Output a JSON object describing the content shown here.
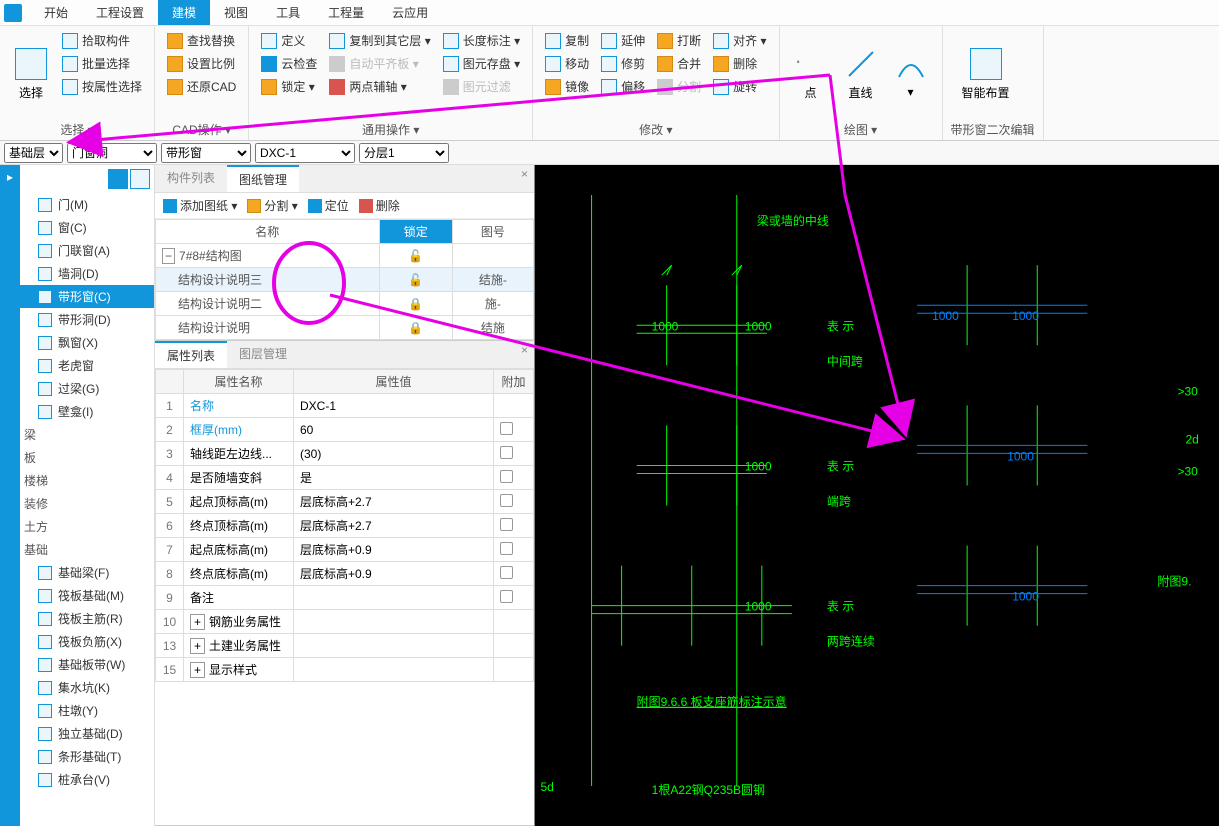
{
  "menu": {
    "items": [
      "开始",
      "工程设置",
      "建模",
      "视图",
      "工具",
      "工程量",
      "云应用"
    ],
    "active_index": 2
  },
  "ribbon": {
    "select_group": {
      "big": "选择",
      "items": [
        "拾取构件",
        "批量选择",
        "按属性选择"
      ],
      "title": "选择 ▾"
    },
    "cad_group": {
      "items": [
        "查找替换",
        "设置比例",
        "还原CAD"
      ],
      "title": "CAD操作 ▾"
    },
    "general_group": {
      "col1": [
        "定义",
        "云检查",
        "锁定 ▾"
      ],
      "col2": [
        "复制到其它层 ▾",
        "自动平齐板 ▾",
        "两点辅轴 ▾"
      ],
      "col3": [
        "长度标注 ▾",
        "图元存盘 ▾",
        "图元过滤"
      ],
      "title": "通用操作 ▾"
    },
    "modify_group": {
      "col1": [
        "复制",
        "移动",
        "镜像"
      ],
      "col2": [
        "延伸",
        "修剪",
        "偏移"
      ],
      "col3": [
        "打断",
        "合并",
        "分割"
      ],
      "col4": [
        "对齐 ▾",
        "删除",
        "旋转"
      ],
      "title": "修改 ▾"
    },
    "draw_group": {
      "items": [
        "点",
        "直线"
      ],
      "title": "绘图 ▾"
    },
    "smart_group": {
      "big": "智能布置",
      "title": "带形窗二次编辑"
    }
  },
  "combos": {
    "layer": "基础层",
    "category": "门窗洞",
    "type": "带形窗",
    "name": "DXC-1",
    "floor": "分层1"
  },
  "tree": {
    "items_top": [
      {
        "label": "门(M)"
      },
      {
        "label": "窗(C)"
      },
      {
        "label": "门联窗(A)"
      },
      {
        "label": "墙洞(D)"
      },
      {
        "label": "带形窗(C)",
        "selected": true
      },
      {
        "label": "带形洞(D)"
      },
      {
        "label": "飘窗(X)"
      },
      {
        "label": "老虎窗"
      },
      {
        "label": "过梁(G)"
      },
      {
        "label": "壁龛(I)"
      }
    ],
    "groups": [
      "梁",
      "板",
      "楼梯",
      "装修",
      "土方"
    ],
    "foundation_label": "基础",
    "foundation_items": [
      "基础梁(F)",
      "筏板基础(M)",
      "筏板主筋(R)",
      "筏板负筋(X)",
      "基础板带(W)",
      "集水坑(K)",
      "柱墩(Y)",
      "独立基础(D)",
      "条形基础(T)",
      "桩承台(V)"
    ]
  },
  "drawing_panel": {
    "tab1": "构件列表",
    "tab2": "图纸管理",
    "toolbar": [
      "添加图纸 ▾",
      "分割 ▾",
      "定位",
      "删除"
    ],
    "headers": {
      "name": "名称",
      "lock": "锁定",
      "num": "图号"
    },
    "rows": [
      {
        "name": "7#8#结构图",
        "expand": "−",
        "lock": "🔓",
        "num": ""
      },
      {
        "name": "结构设计说明三",
        "lock": "🔓",
        "num": "结施-",
        "selected": true
      },
      {
        "name": "结构设计说明二",
        "lock": "🔒",
        "num": "施-"
      },
      {
        "name": "结构设计说明",
        "lock": "🔒",
        "num": "结施"
      }
    ]
  },
  "prop_panel": {
    "tab1": "属性列表",
    "tab2": "图层管理",
    "headers": {
      "name": "属性名称",
      "value": "属性值",
      "extra": "附加"
    },
    "rows": [
      {
        "n": "1",
        "name": "名称",
        "value": "DXC-1",
        "link": true
      },
      {
        "n": "2",
        "name": "框厚(mm)",
        "value": "60",
        "link": true,
        "chk": true
      },
      {
        "n": "3",
        "name": "轴线距左边线...",
        "value": "(30)",
        "chk": true
      },
      {
        "n": "4",
        "name": "是否随墙变斜",
        "value": "是",
        "chk": true
      },
      {
        "n": "5",
        "name": "起点顶标高(m)",
        "value": "层底标高+2.7",
        "chk": true
      },
      {
        "n": "6",
        "name": "终点顶标高(m)",
        "value": "层底标高+2.7",
        "chk": true
      },
      {
        "n": "7",
        "name": "起点底标高(m)",
        "value": "层底标高+0.9",
        "chk": true
      },
      {
        "n": "8",
        "name": "终点底标高(m)",
        "value": "层底标高+0.9",
        "chk": true
      },
      {
        "n": "9",
        "name": "备注",
        "value": "",
        "chk": true
      },
      {
        "n": "10",
        "name": "钢筋业务属性",
        "value": "",
        "expand": true
      },
      {
        "n": "13",
        "name": "土建业务属性",
        "value": "",
        "expand": true
      },
      {
        "n": "15",
        "name": "显示样式",
        "value": "",
        "expand": true
      }
    ]
  },
  "cad": {
    "labels": {
      "beam_center": "梁或墙的中线",
      "dim1000": "1000",
      "mid_span1": "表 示",
      "mid_span2": "中间跨",
      "end_span1": "表 示",
      "end_span2": "端跨",
      "two_span1": "表 示",
      "two_span2": "两跨连续",
      "fig_title": "附图9.6.6  板支座筋标注示意",
      "fig_right": "附图9.",
      "dim_right_top": ">30",
      "dim_right_mid": "2d",
      "dim_right_bot": ">30",
      "bottom_left": "5d",
      "bottom_note": "1根A22钢Q235B圆钢"
    }
  }
}
